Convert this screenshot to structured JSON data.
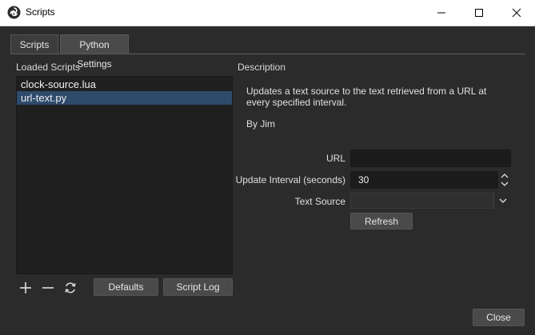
{
  "window": {
    "title": "Scripts",
    "icon": "obs-logo-icon"
  },
  "tabs": [
    {
      "label": "Scripts",
      "active": true
    },
    {
      "label": "Python Settings",
      "active": false
    }
  ],
  "left_panel": {
    "label": "Loaded Scripts",
    "scripts": [
      {
        "name": "clock-source.lua",
        "selected": false
      },
      {
        "name": "url-text.py",
        "selected": true
      }
    ],
    "toolbar": {
      "add_icon": "plus-icon",
      "remove_icon": "minus-icon",
      "reload_icon": "refresh-icon",
      "defaults_label": "Defaults",
      "script_log_label": "Script Log"
    }
  },
  "right_panel": {
    "label": "Description",
    "description": "Updates a text source to the text retrieved from a URL at every specified interval.",
    "author": "By Jim",
    "form": {
      "url_label": "URL",
      "url_value": "",
      "interval_label": "Update Interval (seconds)",
      "interval_value": "30",
      "source_label": "Text Source",
      "source_value": "",
      "refresh_label": "Refresh"
    }
  },
  "footer": {
    "close_label": "Close"
  },
  "colors": {
    "background": "#2b2b2b",
    "selection": "#2e4b6b",
    "field": "#1c1c1c",
    "button": "#4a4a4a"
  }
}
